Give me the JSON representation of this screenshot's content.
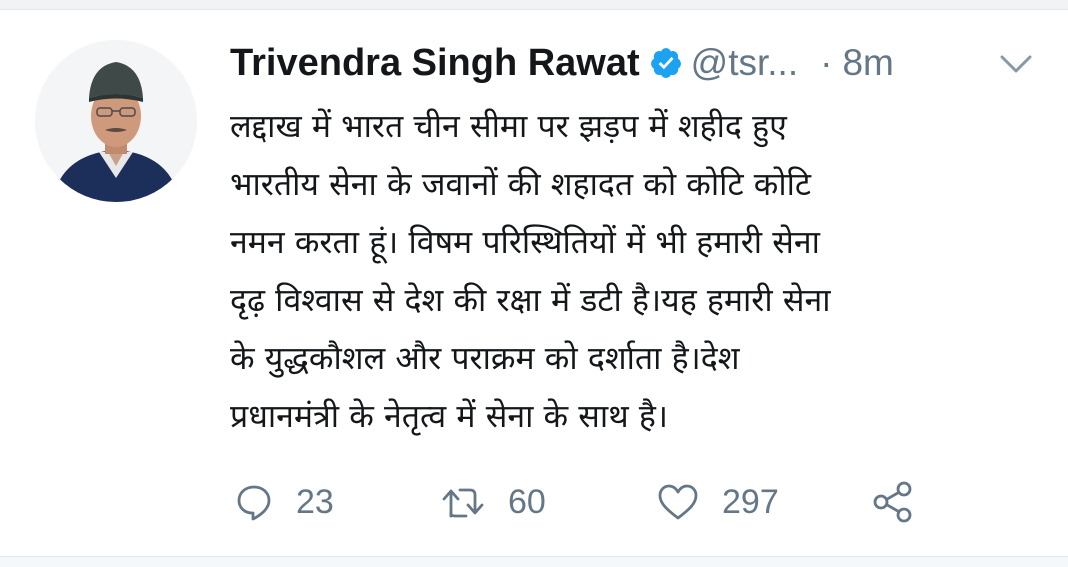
{
  "tweet": {
    "author_name": "Trivendra Singh Rawat",
    "verified": true,
    "handle": "@tsr...",
    "separator": "·",
    "timestamp": "8m",
    "text_lines": [
      "लद्दाख में भारत चीन सीमा पर झड़प में शहीद हुए",
      "भारतीय सेना के जवानों की शहादत को कोटि कोटि",
      "नमन करता हूं। विषम परिस्थितियों में भी हमारी सेना",
      "दृढ़ विश्वास से देश की रक्षा में डटी है।यह हमारी सेना",
      "के युद्धकौशल और पराक्रम को दर्शाता है।देश",
      "प्रधानमंत्री के नेतृत्व में सेना के साथ है।"
    ],
    "replies": "23",
    "retweets": "60",
    "likes": "297"
  },
  "icons": {
    "verified": "verified-badge-icon",
    "menu": "chevron-down-icon",
    "reply": "reply-icon",
    "retweet": "retweet-icon",
    "like": "heart-icon",
    "share": "share-icon"
  },
  "colors": {
    "verified_blue": "#1da1f2",
    "secondary_text": "#657786",
    "primary_text": "#14171a"
  }
}
